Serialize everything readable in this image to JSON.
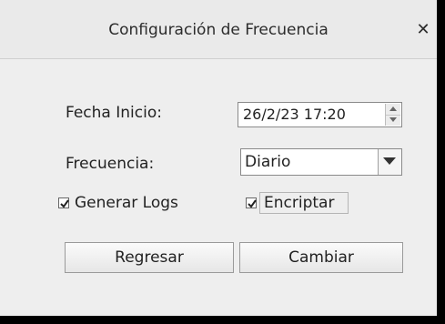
{
  "window": {
    "title": "Configuración de Frecuencia",
    "close_symbol": "✕"
  },
  "form": {
    "start_date_label": "Fecha Inicio:",
    "start_date_value": "26/2/23 17:20",
    "frequency_label": "Frecuencia:",
    "frequency_value": "Diario",
    "generate_logs_label": "Generar Logs",
    "generate_logs_checked": true,
    "encrypt_label": "Encriptar",
    "encrypt_checked": true
  },
  "buttons": {
    "back_label": "Regresar",
    "change_label": "Cambiar"
  },
  "icons": {
    "close": "close-icon",
    "spinner_up": "triangle-up-icon",
    "spinner_down": "triangle-down-icon",
    "combo_arrow": "chevron-down-icon",
    "checkmark": "checkmark-icon"
  }
}
